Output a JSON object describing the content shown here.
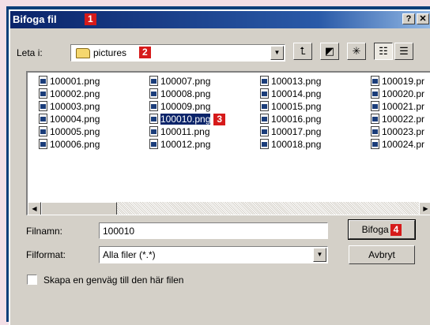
{
  "dialog": {
    "title": "Bifoga fil",
    "marker_1": "1",
    "help_button": "?",
    "close_button": "✕"
  },
  "lookin": {
    "label": "Leta i:",
    "value": "pictures",
    "marker_2": "2",
    "dropdown_arrow": "▼"
  },
  "toolbar": {
    "up_folder_icon": "up-folder-icon",
    "desktop_icon": "desktop-icon",
    "new_folder_icon": "new-folder-icon",
    "list_view_icon": "list-view-icon",
    "details_view_icon": "details-view-icon"
  },
  "files": {
    "col1": [
      "100001.png",
      "100002.png",
      "100003.png",
      "100004.png",
      "100005.png",
      "100006.png"
    ],
    "col2": [
      "100007.png",
      "100008.png",
      "100009.png",
      "100010.png",
      "100011.png",
      "100012.png"
    ],
    "col3": [
      "100013.png",
      "100014.png",
      "100015.png",
      "100016.png",
      "100017.png",
      "100018.png"
    ],
    "col4": [
      "100019.pr",
      "100020.pr",
      "100021.pr",
      "100022.pr",
      "100023.pr",
      "100024.pr"
    ],
    "selected": "100010.png",
    "marker_3": "3"
  },
  "scrollbar": {
    "left_arrow": "◀",
    "right_arrow": "▶"
  },
  "filename": {
    "label": "Filnamn:",
    "value": "100010"
  },
  "filetype": {
    "label": "Filformat:",
    "value": "Alla filer (*.*)"
  },
  "buttons": {
    "attach": "Bifoga",
    "marker_4": "4",
    "cancel": "Avbryt"
  },
  "shortcut": {
    "label": "Skapa en genväg till den här filen"
  },
  "colors": {
    "titlebar": "#0a246a",
    "marker": "#d61a1a",
    "frame": "#0c3f7a",
    "background": "#f3dfe6"
  }
}
